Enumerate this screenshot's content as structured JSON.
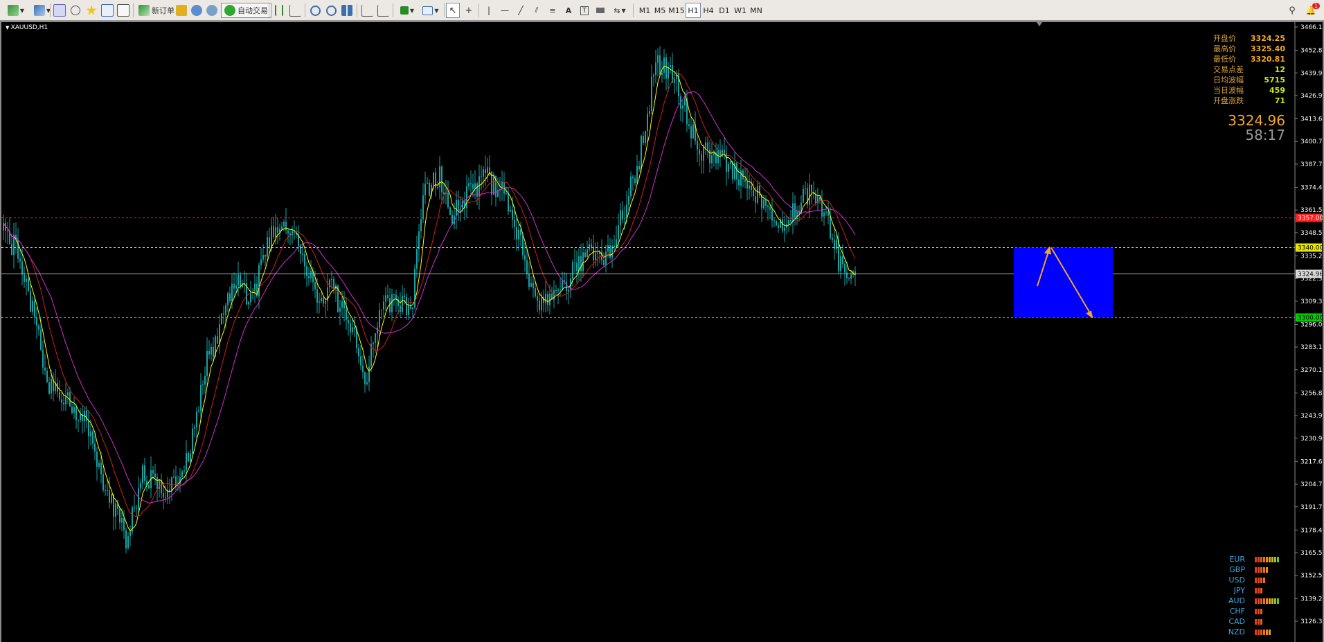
{
  "toolbar": {
    "new_order_label": "新订单",
    "auto_trading_label": "自动交易",
    "timeframes": [
      "M1",
      "M5",
      "M15",
      "H1",
      "H4",
      "D1",
      "W1",
      "MN"
    ],
    "active_timeframe": "H1",
    "alerts_badge": "1"
  },
  "chart": {
    "symbol_label": "XAUUSD,H1",
    "price_axis": [
      "3466.15",
      "3452.85",
      "3439.90",
      "3426.95",
      "3413.65",
      "3400.70",
      "3387.75",
      "3374.45",
      "3361.50",
      "3348.55",
      "3335.25",
      "3322.30",
      "3309.35",
      "3296.05",
      "3283.10",
      "3270.15",
      "3256.85",
      "3243.90",
      "3230.95",
      "3217.65",
      "3204.70",
      "3191.75",
      "3178.45",
      "3165.50",
      "3152.55",
      "3139.25",
      "3126.30"
    ],
    "level_tags": {
      "resistance": "3357.00",
      "entry": "3340.00",
      "current": "3324.96",
      "support": "3300.00"
    },
    "colors": {
      "background": "#000000",
      "candles": "#18a3a3",
      "ma_fast": "#ffff00",
      "ma_mid": "#cc1f1f",
      "ma_slow": "#cc33cc",
      "zone": "#0000ff",
      "arrows": "#f5a623",
      "resistance_line": "#ff2020",
      "entry_line": "#e6e600",
      "support_line": "#00cc00"
    }
  },
  "info_panel": {
    "rows": [
      {
        "label": "开盘价",
        "value": "3324.25",
        "color": "#f5a623"
      },
      {
        "label": "最高价",
        "value": "3325.40",
        "color": "#f5a623"
      },
      {
        "label": "最低价",
        "value": "3320.81",
        "color": "#f5a623"
      },
      {
        "label": "交易点差",
        "value": "12",
        "color": "#c8f000"
      },
      {
        "label": "日均波幅",
        "value": "5715",
        "color": "#c8f000"
      },
      {
        "label": "当日波幅",
        "value": "459",
        "color": "#c8f000"
      },
      {
        "label": "开盘涨跌",
        "value": "71",
        "color": "#c8f000"
      }
    ],
    "current_price": "3324.96",
    "bar_countdown": "58:17"
  },
  "currency_strength": [
    {
      "currency": "EUR",
      "bars": 9
    },
    {
      "currency": "GBP",
      "bars": 5
    },
    {
      "currency": "USD",
      "bars": 4
    },
    {
      "currency": "JPY",
      "bars": 3
    },
    {
      "currency": "AUD",
      "bars": 9
    },
    {
      "currency": "CHF",
      "bars": 3
    },
    {
      "currency": "CAD",
      "bars": 3
    },
    {
      "currency": "NZD",
      "bars": 6
    }
  ]
}
